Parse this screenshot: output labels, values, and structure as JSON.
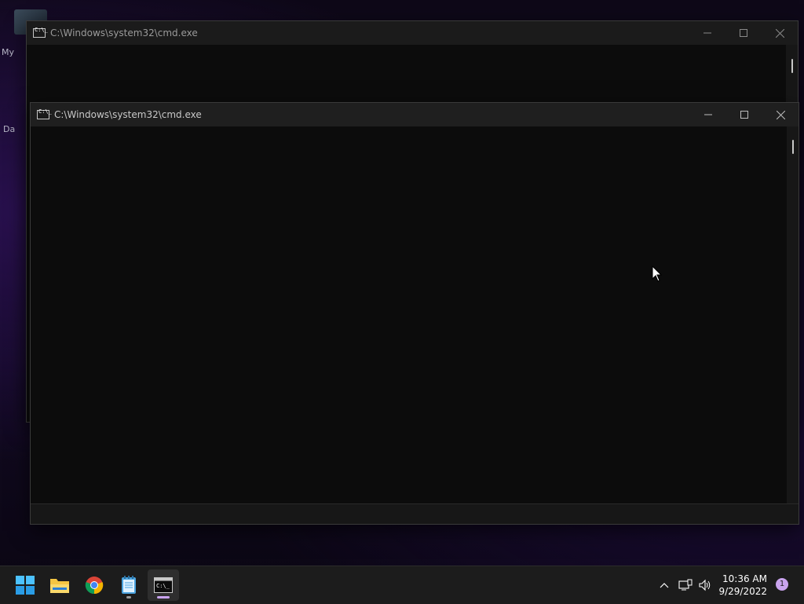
{
  "desktop": {
    "label_top": "My",
    "label_bottom": "Da"
  },
  "windows": {
    "back": {
      "title": "C:\\Windows\\system32\\cmd.exe"
    },
    "front": {
      "title": "C:\\Windows\\system32\\cmd.exe"
    }
  },
  "taskbar": {
    "apps": [
      "start-icon",
      "file-explorer-icon",
      "chrome-icon",
      "notepad-icon",
      "command-prompt-icon"
    ],
    "clock": {
      "time": "10:36 AM",
      "date": "9/29/2022"
    },
    "notification_count": "1"
  },
  "colors": {
    "accent": "#c9a3ee",
    "console_bg": "#0c0c0c",
    "taskbar_bg": "#1c1c1c"
  }
}
